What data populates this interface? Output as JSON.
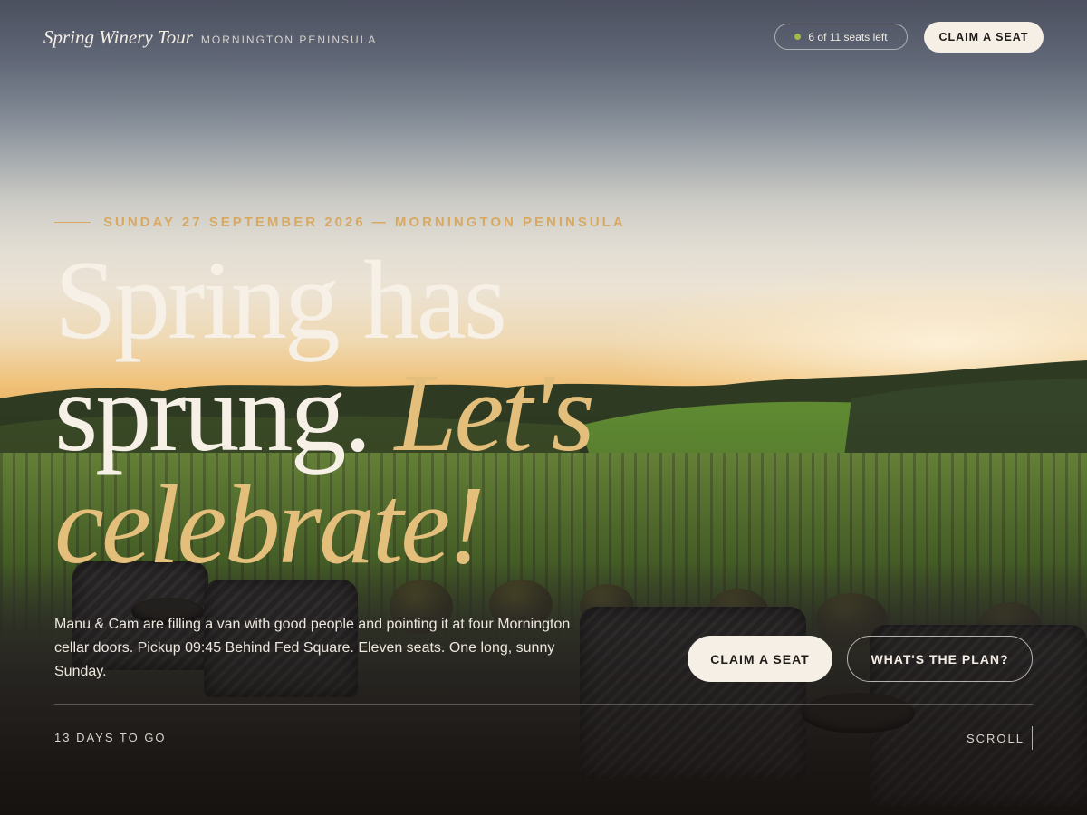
{
  "header": {
    "brand_title": "Spring Winery Tour",
    "brand_subtitle": "MORNINGTON PENINSULA",
    "seats_status": "6 of 11 seats left",
    "cta_label": "CLAIM A SEAT"
  },
  "hero": {
    "eyebrow": "SUNDAY 27 SEPTEMBER 2026 — MORNINGTON PENINSULA",
    "headline_line1": "Spring has",
    "headline_line2_plain": "sprung.",
    "headline_line2_accent": "Let's",
    "headline_line3_accent": "celebrate!",
    "body": "Manu & Cam are filling a van with good people and pointing it at four Mornington cellar doors. Pickup 09:45 Behind Fed Square. Eleven seats. One long, sunny Sunday.",
    "primary_cta": "CLAIM A SEAT",
    "secondary_cta": "WHAT'S THE PLAN?"
  },
  "footer": {
    "countdown": "13 DAYS TO GO",
    "scroll_label": "SCROLL"
  },
  "colors": {
    "accent_gold": "#d8a860",
    "headline_cream": "#f6f0e6",
    "seat_dot_green": "#a6b84a"
  }
}
